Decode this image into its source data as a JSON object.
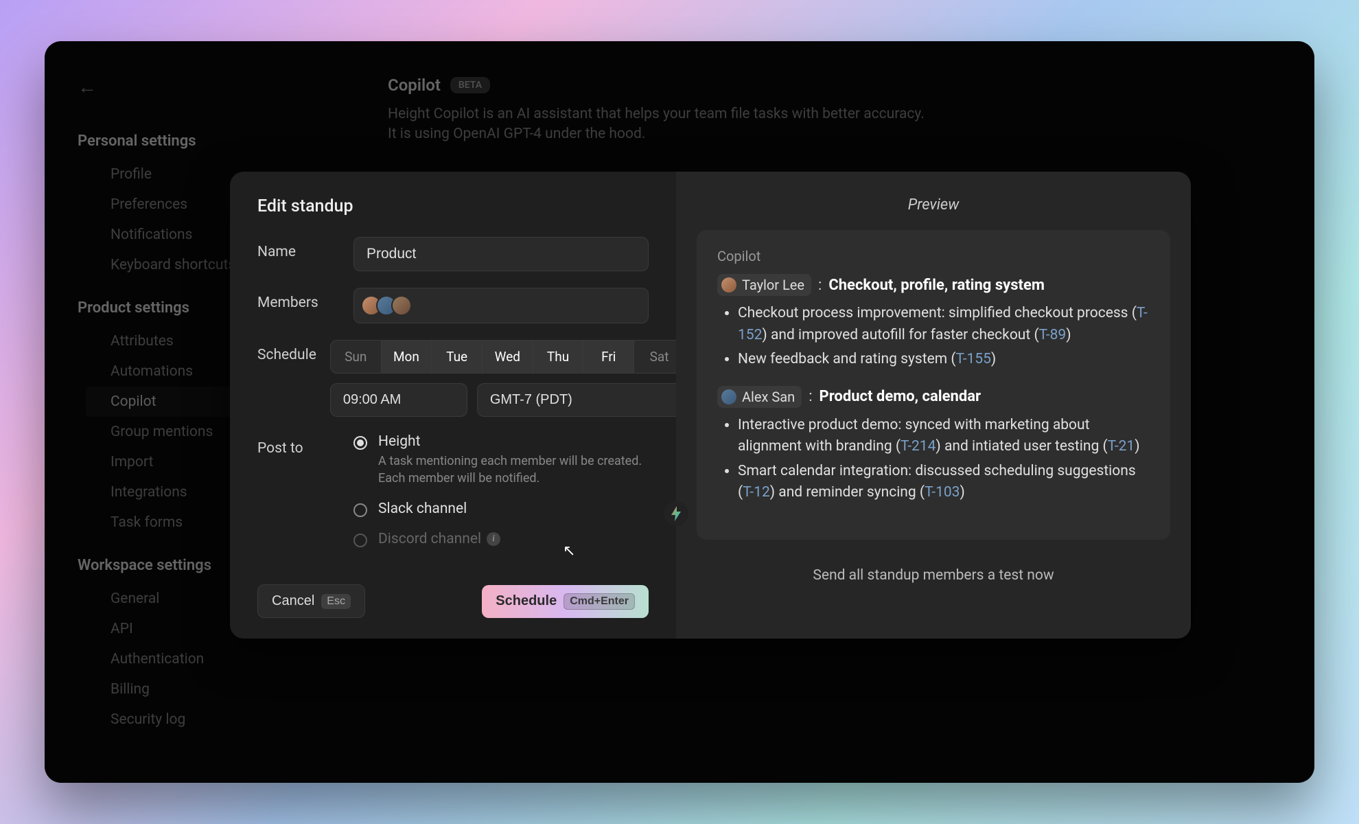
{
  "sidebar": {
    "sections": [
      {
        "heading": "Personal settings",
        "items": [
          "Profile",
          "Preferences",
          "Notifications",
          "Keyboard shortcuts"
        ]
      },
      {
        "heading": "Product settings",
        "items": [
          "Attributes",
          "Automations",
          "Copilot",
          "Group mentions",
          "Import",
          "Integrations",
          "Task forms"
        ]
      },
      {
        "heading": "Workspace settings",
        "items": [
          "General",
          "API",
          "Authentication",
          "Billing",
          "Security log"
        ]
      }
    ],
    "active": "Copilot"
  },
  "page": {
    "title": "Copilot",
    "badge": "BETA",
    "desc1": "Height Copilot is an AI assistant that helps your team file tasks with better accuracy.",
    "desc2": "It is using OpenAI GPT-4 under the hood."
  },
  "modal": {
    "title": "Edit standup",
    "labels": {
      "name": "Name",
      "members": "Members",
      "schedule": "Schedule",
      "post_to": "Post to"
    },
    "name_value": "Product",
    "days": [
      {
        "abbr": "Sun",
        "selected": false
      },
      {
        "abbr": "Mon",
        "selected": true
      },
      {
        "abbr": "Tue",
        "selected": true
      },
      {
        "abbr": "Wed",
        "selected": true
      },
      {
        "abbr": "Thu",
        "selected": true
      },
      {
        "abbr": "Fri",
        "selected": true
      },
      {
        "abbr": "Sat",
        "selected": false
      }
    ],
    "time": "09:00 AM",
    "tz": "GMT-7 (PDT)",
    "post_options": {
      "height": {
        "label": "Height",
        "desc": "A task mentioning each member will be created. Each member will be notified."
      },
      "slack": {
        "label": "Slack channel"
      },
      "discord": {
        "label": "Discord channel"
      }
    },
    "cancel": "Cancel",
    "cancel_kbd": "Esc",
    "schedule": "Schedule",
    "schedule_kbd": "Cmd+Enter"
  },
  "preview": {
    "title": "Preview",
    "heading": "Copilot",
    "send_test": "Send all standup members a test now",
    "entries": [
      {
        "user": "Taylor Lee",
        "summary": "Checkout, profile, rating system",
        "items": [
          {
            "text_pre": "Checkout process improvement: simplified checkout process (",
            "ref1": "T-152",
            "mid": ") and improved autofill for faster checkout (",
            "ref2": "T-89",
            "post": ")"
          },
          {
            "text_pre": "New feedback and rating system (",
            "ref1": "T-155",
            "mid": "",
            "ref2": "",
            "post": ")"
          }
        ]
      },
      {
        "user": "Alex San",
        "summary": "Product demo, calendar",
        "items": [
          {
            "text_pre": "Interactive product demo: synced with marketing about alignment with branding (",
            "ref1": "T-214",
            "mid": ") and intiated user testing (",
            "ref2": "T-21",
            "post": ")"
          },
          {
            "text_pre": "Smart calendar integration: discussed scheduling suggestions (",
            "ref1": "T-12",
            "mid": ") and reminder syncing (",
            "ref2": "T-103",
            "post": ")"
          }
        ]
      }
    ]
  }
}
